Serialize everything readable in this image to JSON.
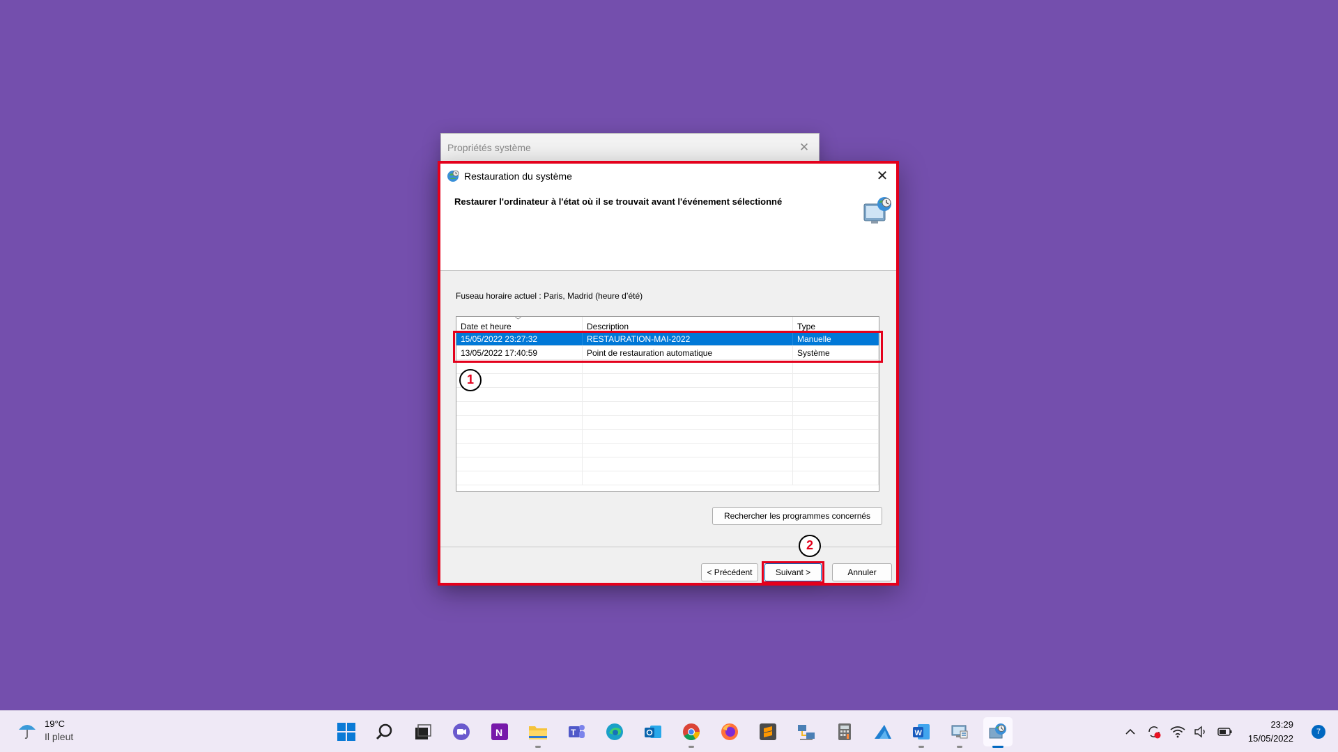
{
  "background_window": {
    "title": "Propriétés système"
  },
  "dialog": {
    "title": "Restauration du système",
    "heading": "Restaurer l'ordinateur à l'état où il se trouvait avant l'événement sélectionné",
    "timezone_label": "Fuseau horaire actuel : Paris, Madrid (heure d’été)",
    "columns": [
      "Date et heure",
      "Description",
      "Type"
    ],
    "rows": [
      {
        "date": "15/05/2022 23:27:32",
        "description": "RESTAURATION-MAI-2022",
        "type": "Manuelle",
        "selected": true
      },
      {
        "date": "13/05/2022 17:40:59",
        "description": "Point de restauration automatique",
        "type": "Système",
        "selected": false
      }
    ],
    "scan_button": "Rechercher les programmes concernés",
    "back_button": "< Précédent",
    "next_button": "Suivant >",
    "cancel_button": "Annuler"
  },
  "annotations": {
    "marker1": "1",
    "marker2": "2",
    "highlight_color": "#e4001c"
  },
  "taskbar": {
    "weather_temp": "19°C",
    "weather_desc": "Il pleut",
    "apps": [
      "start-icon",
      "search-icon",
      "task-view-icon",
      "chat-icon",
      "onenote-icon",
      "file-explorer-icon",
      "teams-icon",
      "edge-icon",
      "outlook-icon",
      "chrome-icon",
      "firefox-icon",
      "sublime-text-icon",
      "network-icon",
      "calculator-icon",
      "shark-icon",
      "word-icon",
      "system-properties-icon",
      "system-restore-icon"
    ],
    "time": "23:29",
    "date": "15/05/2022",
    "notifications": "7"
  },
  "colors": {
    "desktop": "#744fad",
    "selection": "#0078d7",
    "accent": "#0067c0"
  }
}
